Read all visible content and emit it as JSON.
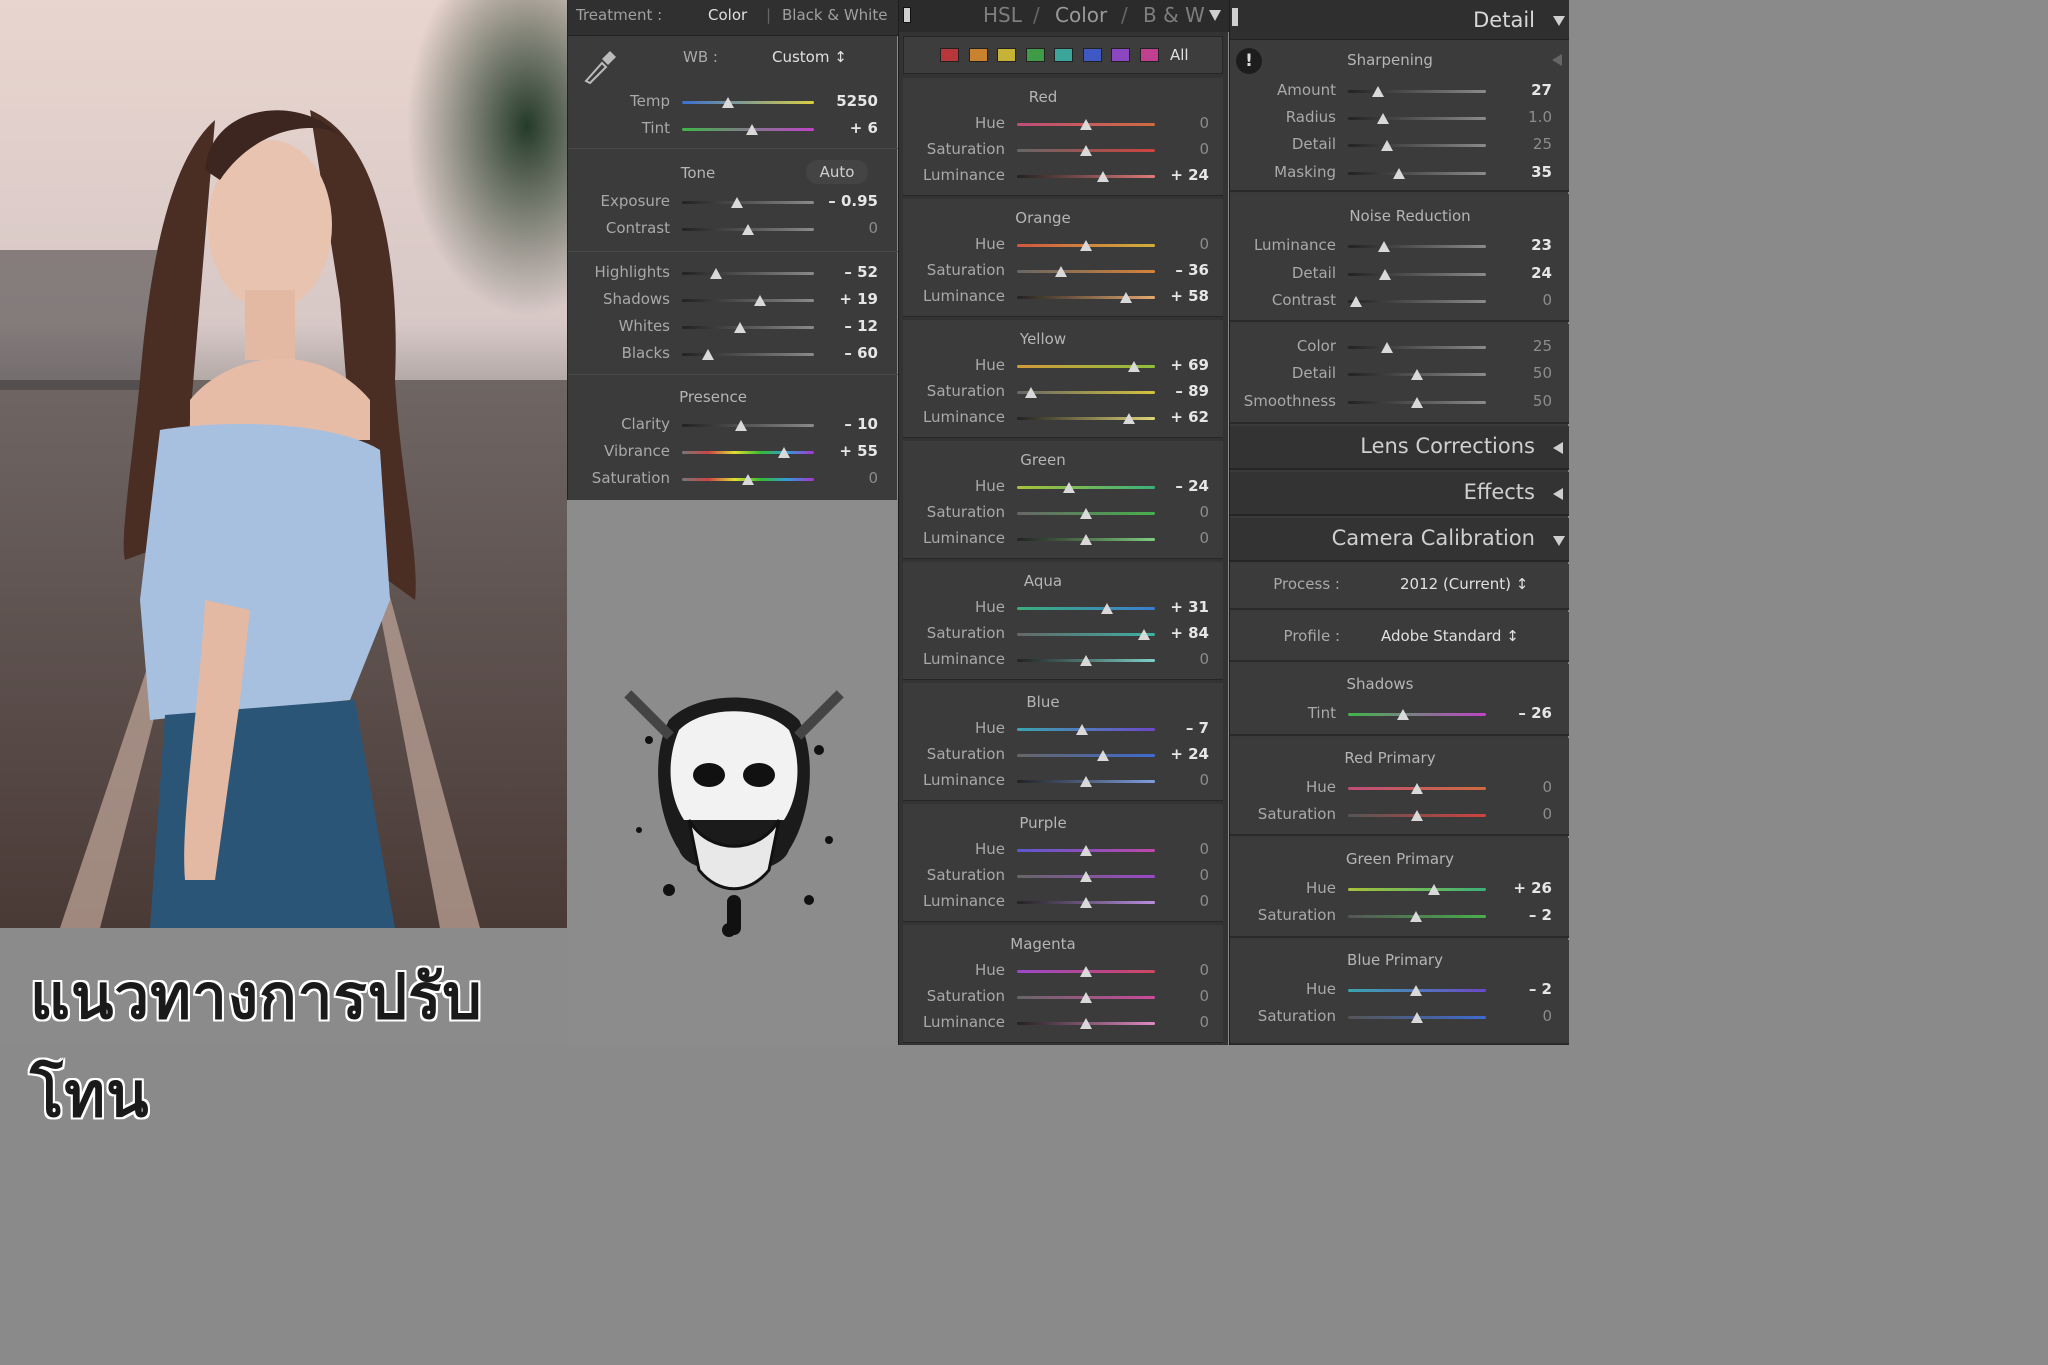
{
  "title_overlay": "แนวทางการปรับโทน",
  "basic": {
    "treatment_label": "Treatment :",
    "treatment_color": "Color",
    "treatment_bw": "Black & White",
    "wb_label": "WB :",
    "wb_value": "Custom ↕",
    "temp": {
      "label": "Temp",
      "value": "5250",
      "pos": 0.35
    },
    "tint": {
      "label": "Tint",
      "value": "+ 6",
      "pos": 0.53
    },
    "tone_label": "Tone",
    "auto_label": "Auto",
    "exposure": {
      "label": "Exposure",
      "value": "– 0.95",
      "pos": 0.42
    },
    "contrast": {
      "label": "Contrast",
      "value": "0",
      "pos": 0.5
    },
    "highlights": {
      "label": "Highlights",
      "value": "– 52",
      "pos": 0.26
    },
    "shadows": {
      "label": "Shadows",
      "value": "+ 19",
      "pos": 0.59
    },
    "whites": {
      "label": "Whites",
      "value": "– 12",
      "pos": 0.44
    },
    "blacks": {
      "label": "Blacks",
      "value": "– 60",
      "pos": 0.2
    },
    "presence_label": "Presence",
    "clarity": {
      "label": "Clarity",
      "value": "– 10",
      "pos": 0.45
    },
    "vibrance": {
      "label": "Vibrance",
      "value": "+ 55",
      "pos": 0.77
    },
    "saturation": {
      "label": "Saturation",
      "value": "0",
      "pos": 0.5
    }
  },
  "hsl": {
    "tab_hsl": "HSL",
    "tab_color": "Color",
    "tab_bw": "B & W",
    "sep": "/",
    "all_label": "All",
    "swatch_colors": [
      "#b8373a",
      "#c9822d",
      "#c5b236",
      "#3f9b45",
      "#3aa598",
      "#3e58c4",
      "#8a47c1",
      "#c0408f"
    ],
    "groups": [
      {
        "name": "Red",
        "hue": "0",
        "sat": "0",
        "lum": "+ 24",
        "hp": 0.5,
        "sp": 0.5,
        "lp": 0.62,
        "colors": [
          "#c04d7a",
          "#d06b3e"
        ],
        "satc": [
          "#666",
          "#d0423e"
        ],
        "lumc": [
          "#222",
          "#e07a7a"
        ]
      },
      {
        "name": "Orange",
        "hue": "0",
        "sat": "– 36",
        "lum": "+ 58",
        "hp": 0.5,
        "sp": 0.32,
        "lp": 0.79,
        "colors": [
          "#d2573f",
          "#d0b03a"
        ],
        "satc": [
          "#666",
          "#d98236"
        ],
        "lumc": [
          "#222",
          "#e5a870"
        ]
      },
      {
        "name": "Yellow",
        "hue": "+ 69",
        "sat": "– 89",
        "lum": "+ 62",
        "hp": 0.85,
        "sp": 0.1,
        "lp": 0.81,
        "colors": [
          "#d19a3a",
          "#8fbf3a"
        ],
        "satc": [
          "#666",
          "#d4c43c"
        ],
        "lumc": [
          "#222",
          "#e0d478"
        ]
      },
      {
        "name": "Green",
        "hue": "– 24",
        "sat": "0",
        "lum": "0",
        "hp": 0.38,
        "sp": 0.5,
        "lp": 0.5,
        "colors": [
          "#a7c23a",
          "#3ab07a"
        ],
        "satc": [
          "#666",
          "#48b04c"
        ],
        "lumc": [
          "#222",
          "#7fcc7f"
        ]
      },
      {
        "name": "Aqua",
        "hue": "+ 31",
        "sat": "+ 84",
        "lum": "0",
        "hp": 0.65,
        "sp": 0.92,
        "lp": 0.5,
        "colors": [
          "#3ab07a",
          "#3a7dd0"
        ],
        "satc": [
          "#666",
          "#3ab2a6"
        ],
        "lumc": [
          "#222",
          "#7fd0c8"
        ]
      },
      {
        "name": "Blue",
        "hue": "– 7",
        "sat": "+ 24",
        "lum": "0",
        "hp": 0.47,
        "sp": 0.62,
        "lp": 0.5,
        "colors": [
          "#3aa5b0",
          "#6a48c9"
        ],
        "satc": [
          "#666",
          "#3e6ad0"
        ],
        "lumc": [
          "#222",
          "#7f9ee0"
        ]
      },
      {
        "name": "Purple",
        "hue": "0",
        "sat": "0",
        "lum": "0",
        "hp": 0.5,
        "sp": 0.5,
        "lp": 0.5,
        "colors": [
          "#5b58cf",
          "#c047a8"
        ],
        "satc": [
          "#666",
          "#9a49c9"
        ],
        "lumc": [
          "#222",
          "#b98fe0"
        ]
      },
      {
        "name": "Magenta",
        "hue": "0",
        "sat": "0",
        "lum": "0",
        "hp": 0.5,
        "sp": 0.5,
        "lp": 0.5,
        "colors": [
          "#9a49c9",
          "#d04560"
        ],
        "satc": [
          "#666",
          "#cc4a9c"
        ],
        "lumc": [
          "#222",
          "#e08ac2"
        ]
      }
    ],
    "hue_label": "Hue",
    "sat_label": "Saturation",
    "lum_label": "Luminance"
  },
  "detail": {
    "title": "Detail",
    "sharpening": "Sharpening",
    "amount": {
      "label": "Amount",
      "value": "27",
      "pos": 0.22
    },
    "radius": {
      "label": "Radius",
      "value": "1.0",
      "pos": 0.25
    },
    "detail": {
      "label": "Detail",
      "value": "25",
      "pos": 0.28
    },
    "masking": {
      "label": "Masking",
      "value": "35",
      "pos": 0.37
    },
    "noise": "Noise Reduction",
    "nr_lum": {
      "label": "Luminance",
      "value": "23",
      "pos": 0.26
    },
    "nr_detail": {
      "label": "Detail",
      "value": "24",
      "pos": 0.27
    },
    "nr_contrast": {
      "label": "Contrast",
      "value": "0",
      "pos": 0.06
    },
    "nr_color": {
      "label": "Color",
      "value": "25",
      "pos": 0.28
    },
    "nr_cdetail": {
      "label": "Detail",
      "value": "50",
      "pos": 0.5
    },
    "nr_smooth": {
      "label": "Smoothness",
      "value": "50",
      "pos": 0.5
    }
  },
  "lens": "Lens Corrections",
  "effects": "Effects",
  "calibration": {
    "title": "Camera Calibration",
    "process_label": "Process :",
    "process_value": "2012 (Current) ↕",
    "profile_label": "Profile :",
    "profile_value": "Adobe Standard ↕",
    "shadows": "Shadows",
    "tint": {
      "label": "Tint",
      "value": "– 26",
      "pos": 0.4
    },
    "red_primary": "Red Primary",
    "red_hue": {
      "label": "Hue",
      "value": "0",
      "pos": 0.5
    },
    "red_sat": {
      "label": "Saturation",
      "value": "0",
      "pos": 0.5
    },
    "green_primary": "Green Primary",
    "green_hue": {
      "label": "Hue",
      "value": "+ 26",
      "pos": 0.62
    },
    "green_sat": {
      "label": "Saturation",
      "value": "– 2",
      "pos": 0.49
    },
    "blue_primary": "Blue Primary",
    "blue_hue": {
      "label": "Hue",
      "value": "– 2",
      "pos": 0.49
    },
    "blue_sat": {
      "label": "Saturation",
      "value": "0",
      "pos": 0.5
    }
  }
}
